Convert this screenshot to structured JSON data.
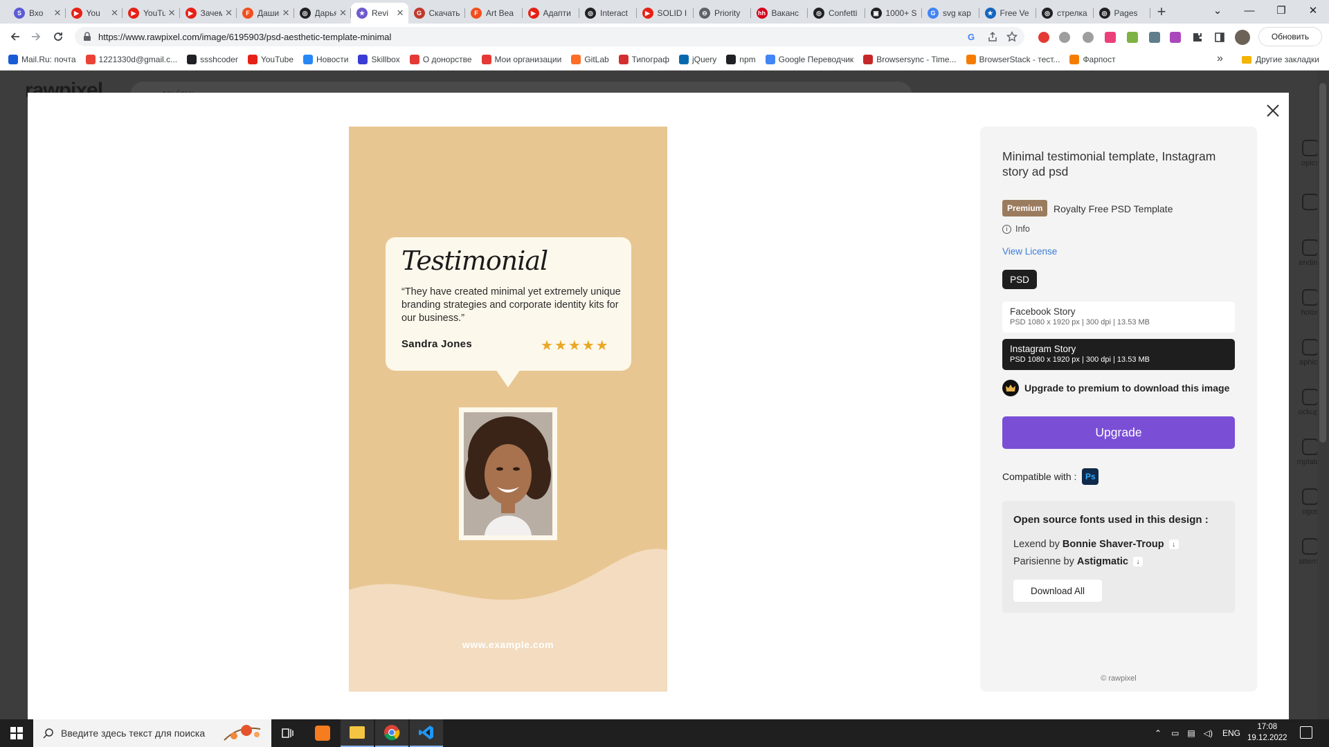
{
  "browser": {
    "tabs": [
      {
        "label": "Вхо",
        "color": "#5b5bd6",
        "glyph": "S"
      },
      {
        "label": "You",
        "color": "#e62117",
        "glyph": "▶"
      },
      {
        "label": "YouTub",
        "color": "#e62117",
        "glyph": "▶"
      },
      {
        "label": "Зачем у",
        "color": "#e62117",
        "glyph": "▶"
      },
      {
        "label": "Дашин",
        "color": "#f24e1e",
        "glyph": "F"
      },
      {
        "label": "Дарья I",
        "color": "#202124",
        "glyph": "◎"
      },
      {
        "label": "Revi",
        "color": "#6d5bd0",
        "glyph": "★"
      },
      {
        "label": "Скачать",
        "color": "#c0392b",
        "glyph": "G"
      },
      {
        "label": "Art Bea",
        "color": "#f24e1e",
        "glyph": "F"
      },
      {
        "label": "Адапти",
        "color": "#e62117",
        "glyph": "▶"
      },
      {
        "label": "Interact",
        "color": "#202124",
        "glyph": "◎"
      },
      {
        "label": "SOLID I",
        "color": "#e62117",
        "glyph": "▶"
      },
      {
        "label": "Priority",
        "color": "#5f6368",
        "glyph": "⊖"
      },
      {
        "label": "Ваканс",
        "color": "#d6001c",
        "glyph": "hh"
      },
      {
        "label": "Confetti",
        "color": "#202124",
        "glyph": "◎"
      },
      {
        "label": "1000+ S",
        "color": "#202124",
        "glyph": "▣"
      },
      {
        "label": "svg кар",
        "color": "#4285f4",
        "glyph": "G"
      },
      {
        "label": "Free Ve",
        "color": "#1565c0",
        "glyph": "★"
      },
      {
        "label": "стрелка",
        "color": "#202124",
        "glyph": "◎"
      },
      {
        "label": "Pages",
        "color": "#202124",
        "glyph": "◎"
      }
    ],
    "active_tab_index": 6,
    "url": "https://www.rawpixel.com/image/6195903/psd-aesthetic-template-minimal",
    "update_label": "Обновить",
    "bookmarks": [
      {
        "label": "Mail.Ru: почта",
        "color": "#1a5bd6"
      },
      {
        "label": "1221330d@gmail.c...",
        "color": "#ea4335"
      },
      {
        "label": "ssshcoder",
        "color": "#202124"
      },
      {
        "label": "YouTube",
        "color": "#e62117"
      },
      {
        "label": "Новости",
        "color": "#2787f5"
      },
      {
        "label": "Skillbox",
        "color": "#3b3bd6"
      },
      {
        "label": "О донорстве",
        "color": "#e53935"
      },
      {
        "label": "Мои организации",
        "color": "#e53935"
      },
      {
        "label": "GitLab",
        "color": "#fc6d26"
      },
      {
        "label": "Типограф",
        "color": "#d32f2f"
      },
      {
        "label": "jQuery",
        "color": "#0769ad"
      },
      {
        "label": "npm",
        "color": "#202124"
      },
      {
        "label": "Google Переводчик",
        "color": "#4285f4"
      },
      {
        "label": "Browsersync - Time...",
        "color": "#c62828"
      },
      {
        "label": "BrowserStack - тест...",
        "color": "#f57c00"
      },
      {
        "label": "Фарпост",
        "color": "#f57c00"
      }
    ],
    "other_bookmarks": "Другие закладки"
  },
  "site": {
    "logo": "rawpixel",
    "search_text": "review",
    "rail_items": [
      "opics",
      "",
      "ending",
      "hotos",
      "aphics",
      "ockups",
      "mplates",
      "ogos",
      "atterns"
    ]
  },
  "preview": {
    "title": "Testimonial",
    "quote": "“They have created minimal yet extremely unique branding strategies and corporate identity kits for our business.”",
    "name": "Sandra Jones",
    "stars": [
      "★",
      "★",
      "★",
      "★",
      "★"
    ],
    "website": "www.example.com",
    "colors": {
      "bg": "#e8c692",
      "wave": "#f3dcc0",
      "card": "#fdf8ec",
      "star": "#e9a726"
    }
  },
  "panel": {
    "title": "Minimal testimonial template, Instagram story ad psd",
    "badge": "Premium",
    "license_type": "Royalty Free PSD Template",
    "info": "Info",
    "view_license": "View License",
    "format": "PSD",
    "options": [
      {
        "name": "Facebook Story",
        "meta": "PSD 1080 x 1920 px | 300 dpi | 13.53 MB"
      },
      {
        "name": "Instagram Story",
        "meta": "PSD 1080 x 1920 px | 300 dpi | 13.53 MB"
      }
    ],
    "upgrade_note": "Upgrade to premium to download this image",
    "upgrade_button": "Upgrade",
    "compatible_label": "Compatible with :",
    "ps_label": "Ps",
    "fonts_title": "Open source fonts used in this design :",
    "fonts": [
      {
        "name": "Lexend by",
        "author": "Bonnie Shaver-Troup"
      },
      {
        "name": "Parisienne by",
        "author": "Astigmatic"
      }
    ],
    "download_all": "Download All",
    "copyright": "© rawpixel",
    "accent": "#7a4fd6"
  },
  "taskbar": {
    "search_placeholder": "Введите здесь текст для поиска",
    "lang": "ENG",
    "time": "17:08",
    "date": "19.12.2022"
  }
}
